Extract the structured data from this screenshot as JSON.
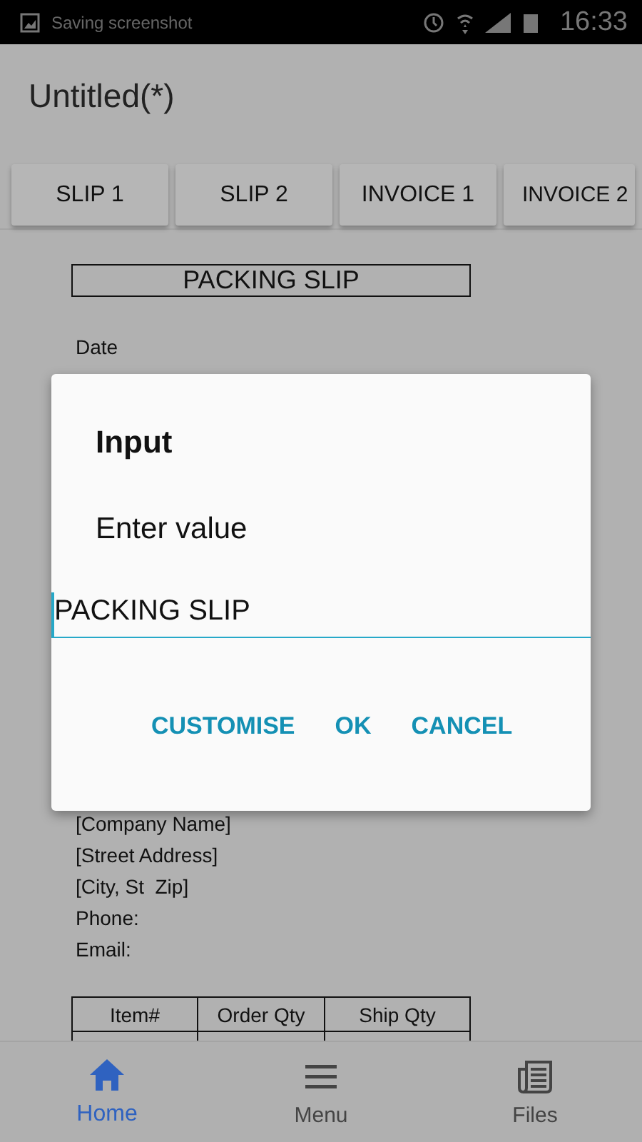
{
  "status_bar": {
    "notification": "Saving screenshot",
    "time": "16:33"
  },
  "app_bar": {
    "title": "Untitled(*)"
  },
  "tabs": [
    {
      "label": "SLIP 1"
    },
    {
      "label": "SLIP 2"
    },
    {
      "label": "INVOICE 1"
    },
    {
      "label": "INVOICE 2"
    }
  ],
  "document": {
    "heading": "PACKING SLIP",
    "date_label": "Date",
    "address_lines": [
      "[Company Name]",
      "[Street Address]",
      "[City, St  Zip]",
      "Phone:",
      "Email:"
    ],
    "table": {
      "columns": [
        "Item#",
        "Order Qty",
        "Ship Qty"
      ]
    }
  },
  "dialog": {
    "title": "Input",
    "message": "Enter value",
    "value": "PACKING SLIP",
    "buttons": [
      "CUSTOMISE",
      "OK",
      "CANCEL"
    ]
  },
  "bottom_nav": [
    {
      "label": "Home",
      "selected": true
    },
    {
      "label": "Menu",
      "selected": false
    },
    {
      "label": "Files",
      "selected": false
    }
  ]
}
